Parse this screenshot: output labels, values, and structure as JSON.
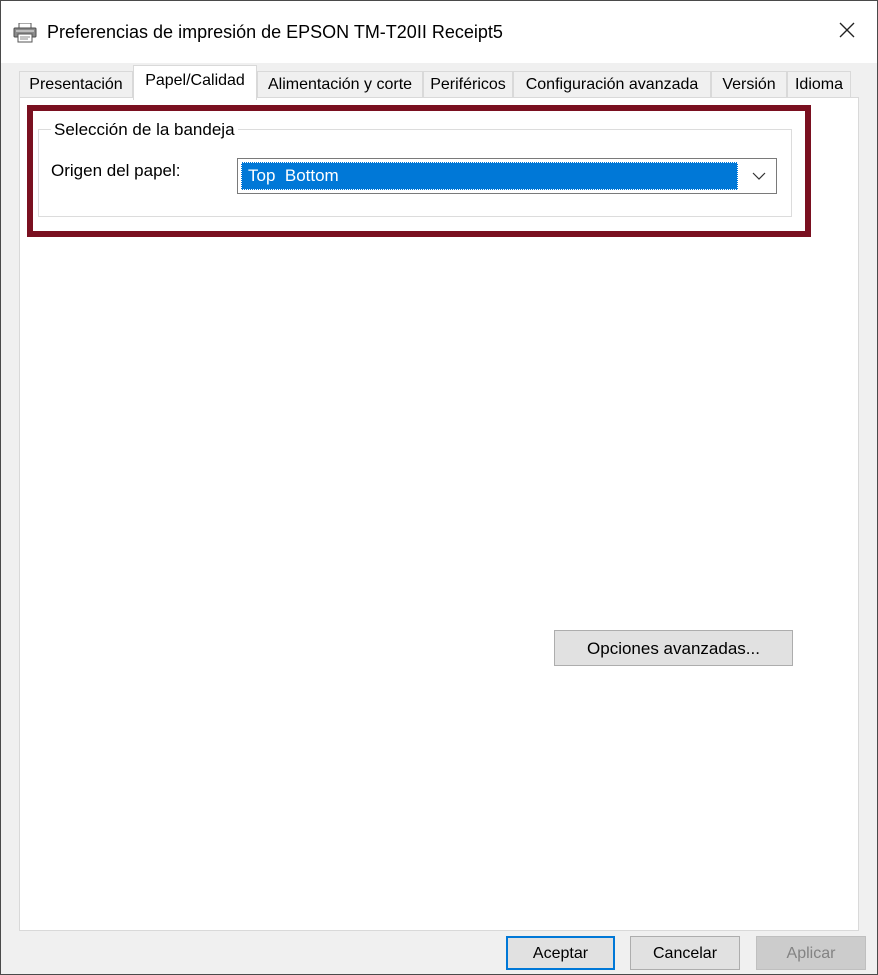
{
  "window": {
    "title": "Preferencias de impresión de EPSON TM-T20II Receipt5",
    "icon": "printer-icon",
    "close_glyph": "✕"
  },
  "tabs": [
    {
      "label": "Presentación",
      "active": false
    },
    {
      "label": "Papel/Calidad",
      "active": true
    },
    {
      "label": "Alimentación y corte",
      "active": false
    },
    {
      "label": "Periféricos",
      "active": false
    },
    {
      "label": "Configuración avanzada",
      "active": false
    },
    {
      "label": "Versión",
      "active": false
    },
    {
      "label": "Idioma",
      "active": false
    }
  ],
  "tray_group": {
    "legend": "Selección de la bandeja",
    "paper_source_label": "Origen del papel:",
    "paper_source_value": "Top  Bottom"
  },
  "buttons": {
    "advanced": "Opciones avanzadas...",
    "ok": "Aceptar",
    "cancel": "Cancelar",
    "apply": "Aplicar"
  },
  "colors": {
    "highlight_border": "#7a1020",
    "selection": "#0078d7"
  }
}
